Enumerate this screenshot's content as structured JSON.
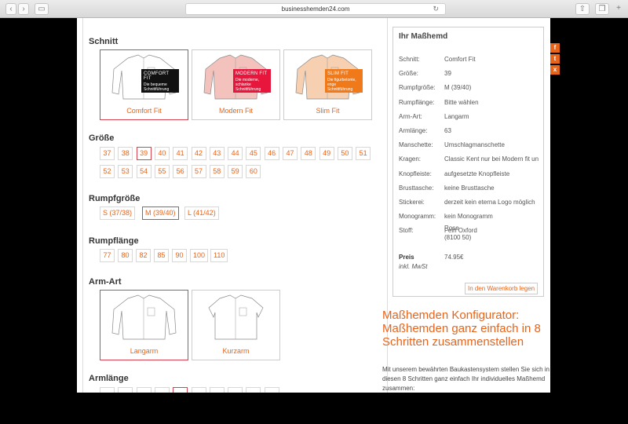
{
  "browser": {
    "url": "businesshemden24.com",
    "back_icon": "chevron-left",
    "forward_icon": "chevron-right"
  },
  "schnitt": {
    "title": "Schnitt",
    "items": [
      {
        "label": "Comfort Fit",
        "tag_title": "COMFORT FIT",
        "tag_text": "Die bequeme Schnittführung",
        "tag_color": "#111111",
        "shirt_color": "#ffffff",
        "selected": true
      },
      {
        "label": "Modern Fit",
        "tag_title": "MODERN FIT",
        "tag_text": "Die moderne, schlanke Schnittführung",
        "tag_color": "#e8163c",
        "shirt_color": "#f3c2bd",
        "selected": false
      },
      {
        "label": "Slim Fit",
        "tag_title": "SLIM FIT",
        "tag_text": "Die figurbetonte, enge Schnittführung",
        "tag_color": "#f07a1a",
        "shirt_color": "#f6d0b0",
        "selected": false
      }
    ]
  },
  "groesse": {
    "title": "Größe",
    "row1": [
      "37",
      "38",
      "39",
      "40",
      "41",
      "42",
      "43",
      "44",
      "45",
      "46",
      "47",
      "48",
      "49",
      "50",
      "51"
    ],
    "row2": [
      "52",
      "53",
      "54",
      "55",
      "56",
      "57",
      "58",
      "59",
      "60"
    ],
    "selected": "39"
  },
  "rumpfgroesse": {
    "title": "Rumpfgröße",
    "options": [
      "S (37/38)",
      "M (39/40)",
      "L (41/42)"
    ],
    "selected": "M (39/40)"
  },
  "rumpflaenge": {
    "title": "Rumpflänge",
    "options": [
      "77",
      "80",
      "82",
      "85",
      "90",
      "100",
      "110"
    ]
  },
  "armart": {
    "title": "Arm-Art",
    "items": [
      {
        "label": "Langarm",
        "selected": true
      },
      {
        "label": "Kurzarm",
        "selected": false
      }
    ]
  },
  "armlaenge": {
    "title": "Armlänge"
  },
  "summary": {
    "title": "Ihr Maßhemd",
    "rows": [
      {
        "k": "Schnitt:",
        "v": "Comfort Fit"
      },
      {
        "k": "Größe:",
        "v": "39"
      },
      {
        "k": "Rumpfgröße:",
        "v": "M (39/40)"
      },
      {
        "k": "Rumpflänge:",
        "v": "Bitte wählen"
      },
      {
        "k": "Arm-Art:",
        "v": "Langarm"
      },
      {
        "k": "Armlänge:",
        "v": "63"
      },
      {
        "k": "Manschette:",
        "v": "Umschlagmanschette"
      },
      {
        "k": "Kragen:",
        "v": "Classic Kent nur bei Modern fit un"
      },
      {
        "k": "Knopfleiste:",
        "v": "aufgesetzte Knopfleiste"
      },
      {
        "k": "Brusttasche:",
        "v": "keine Brusttasche"
      },
      {
        "k": "Stickerei:",
        "v": "derzeit kein eterna Logo möglich"
      },
      {
        "k": "Monogramm:",
        "v": "kein Monogramm"
      },
      {
        "k": "Stoff:",
        "v": "Fein Oxford"
      }
    ],
    "stoff_line2": "Rose",
    "stoff_line3": "(8100 50)",
    "preis_label": "Preis",
    "preis_note": "inkl. MwSt",
    "preis_value": "74.95€",
    "cart_button": "In den Warenkorb legen"
  },
  "headline": "Maßhemden Konfigurator: Maßhemden ganz einfach in 8 Schritten zusammenstellen",
  "intro": "Mit unserem bewährten Baukastensystem stellen Sie sich in diesen 8 Schritten ganz einfach Ihr individuelles Maßhemd zusammen:",
  "social": [
    "f",
    "t",
    "x"
  ]
}
